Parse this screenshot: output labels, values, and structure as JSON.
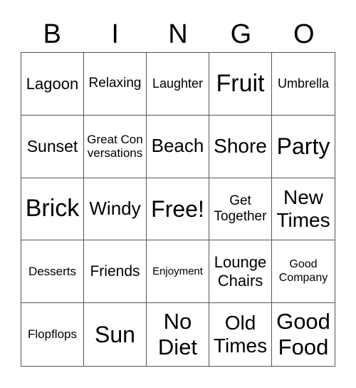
{
  "header": [
    "B",
    "I",
    "N",
    "G",
    "O"
  ],
  "cells": [
    {
      "text": "Lagoon",
      "size": 22
    },
    {
      "text": "Relaxing",
      "size": 19
    },
    {
      "text": "Laughter",
      "size": 18
    },
    {
      "text": "Fruit",
      "size": 34
    },
    {
      "text": "Umbrella",
      "size": 18
    },
    {
      "text": "Sunset",
      "size": 23
    },
    {
      "text": "Great Conversations",
      "size": 17
    },
    {
      "text": "Beach",
      "size": 26
    },
    {
      "text": "Shore",
      "size": 28
    },
    {
      "text": "Party",
      "size": 32
    },
    {
      "text": "Brick",
      "size": 34
    },
    {
      "text": "Windy",
      "size": 26
    },
    {
      "text": "Free!",
      "size": 32
    },
    {
      "text": "Get Together",
      "size": 19
    },
    {
      "text": "New Times",
      "size": 28
    },
    {
      "text": "Desserts",
      "size": 17
    },
    {
      "text": "Friends",
      "size": 21
    },
    {
      "text": "Enjoyment",
      "size": 15
    },
    {
      "text": "Lounge Chairs",
      "size": 22
    },
    {
      "text": "Good Company",
      "size": 16
    },
    {
      "text": "Flopflops",
      "size": 17
    },
    {
      "text": "Sun",
      "size": 32
    },
    {
      "text": "No Diet",
      "size": 31
    },
    {
      "text": "Old Times",
      "size": 28
    },
    {
      "text": "Good Food",
      "size": 31
    }
  ]
}
